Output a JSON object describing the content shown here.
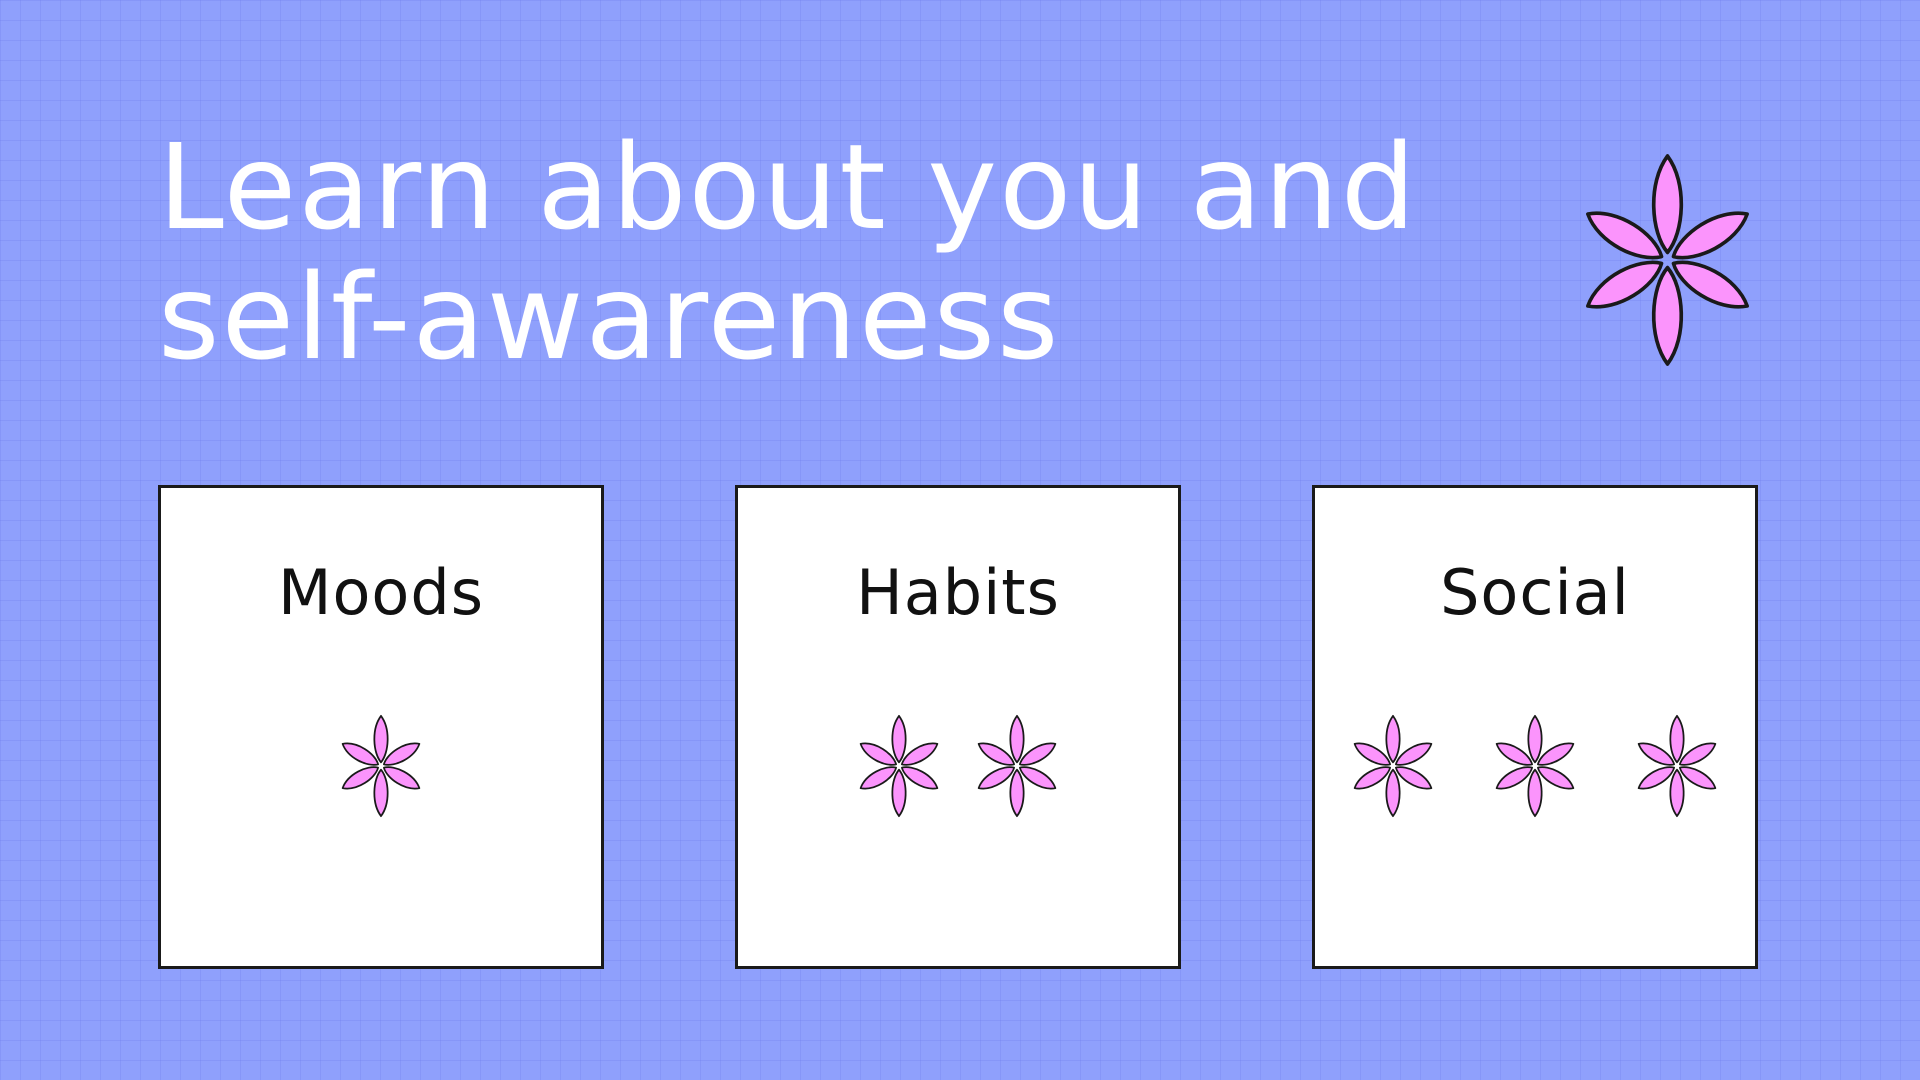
{
  "slide": {
    "title_line1": "Learn about you and",
    "title_line2": "self-awareness",
    "decor_icon": "flower-icon"
  },
  "colors": {
    "background": "#8fa0fc",
    "flower_fill": "#fb94fc",
    "outline": "#1a1a1a",
    "title_text": "#ffffff",
    "card_text": "#111111"
  },
  "cards": [
    {
      "label": "Moods",
      "flower_count": 1
    },
    {
      "label": "Habits",
      "flower_count": 2
    },
    {
      "label": "Social",
      "flower_count": 3
    }
  ]
}
